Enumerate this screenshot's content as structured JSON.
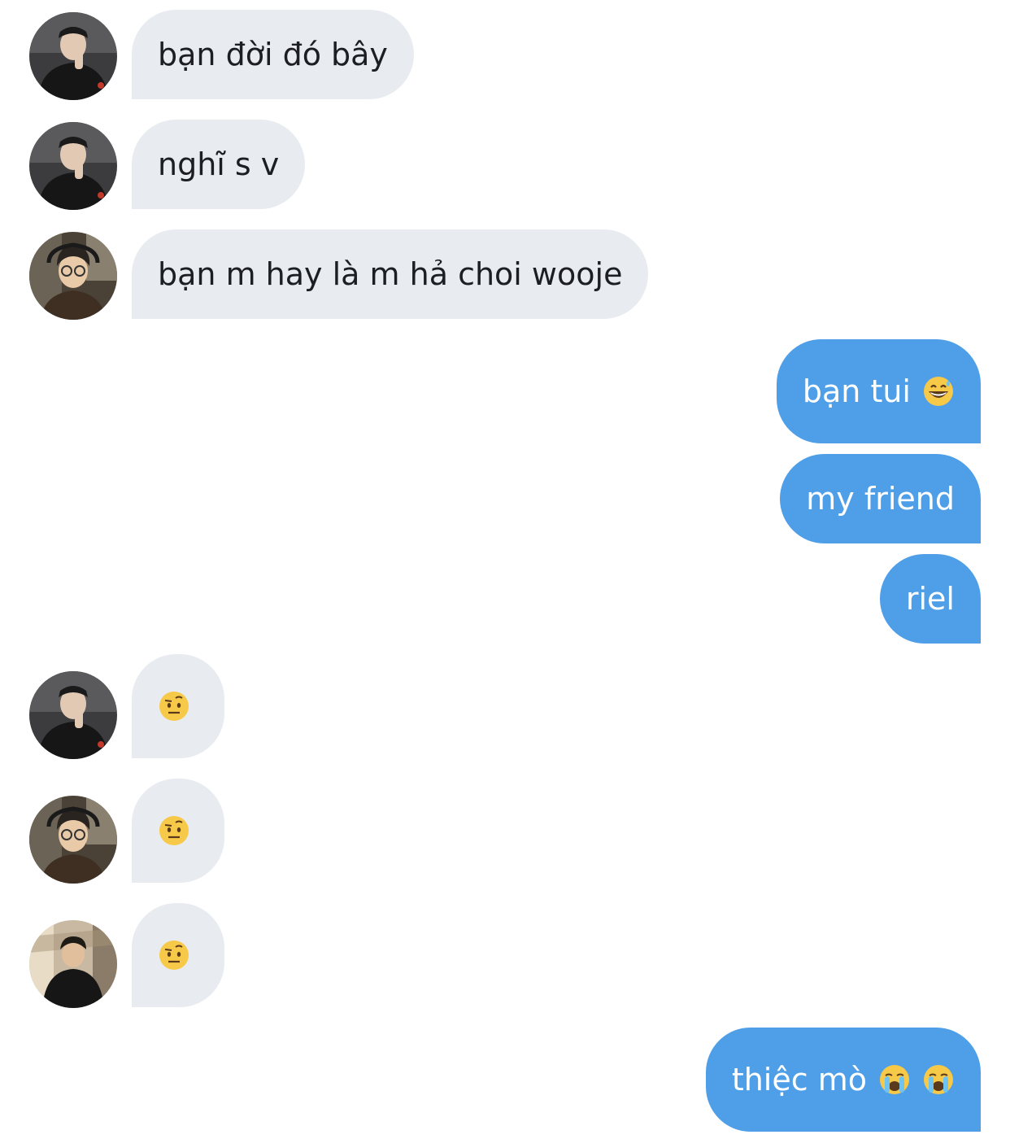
{
  "messages": [
    {
      "side": "in",
      "sender": "user-a",
      "text": "bạn đời đó bây"
    },
    {
      "side": "in",
      "sender": "user-a",
      "text": "nghĩ s v"
    },
    {
      "side": "in",
      "sender": "user-b",
      "text": "bạn m hay là m hả choi wooje"
    },
    {
      "side": "out",
      "text": "bạn tui",
      "emoji": [
        "grinning-sweat-emoji"
      ]
    },
    {
      "side": "out",
      "text": "my friend"
    },
    {
      "side": "out",
      "text": "riel"
    },
    {
      "side": "in",
      "sender": "user-a",
      "emoji": [
        "raised-eyebrow-emoji"
      ]
    },
    {
      "side": "in",
      "sender": "user-b",
      "emoji": [
        "raised-eyebrow-emoji"
      ]
    },
    {
      "side": "in",
      "sender": "user-c",
      "emoji": [
        "raised-eyebrow-emoji"
      ]
    },
    {
      "side": "out",
      "text": "thiệc mò",
      "emoji": [
        "loudly-crying-emoji",
        "loudly-crying-emoji"
      ]
    }
  ],
  "colors": {
    "incoming_bubble": "#e8ebef",
    "outgoing_bubble": "#4f9ee8",
    "background": "#ffffff"
  }
}
